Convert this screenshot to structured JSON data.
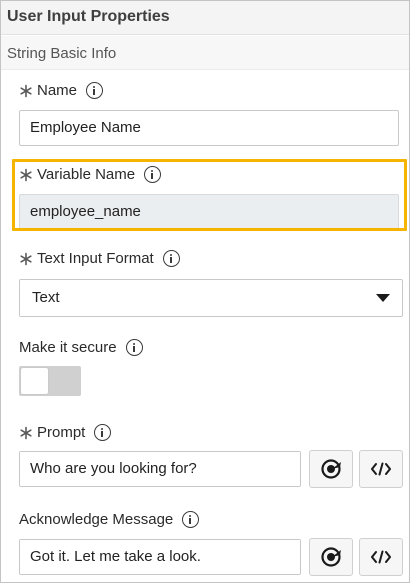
{
  "panel": {
    "title": "User Input Properties"
  },
  "section": {
    "title": "String Basic Info"
  },
  "fields": {
    "name": {
      "label": "Name",
      "value": "Employee Name",
      "required": true
    },
    "variable_name": {
      "label": "Variable Name",
      "value": "employee_name",
      "required": true,
      "read_only": true
    },
    "text_input_format": {
      "label": "Text Input Format",
      "selected": "Text",
      "required": true
    },
    "make_it_secure": {
      "label": "Make it secure",
      "on": false
    },
    "prompt": {
      "label": "Prompt",
      "value": "Who are you looking for?",
      "required": true
    },
    "acknowledge_message": {
      "label": "Acknowledge Message",
      "value": "Got it. Let me take a look."
    }
  },
  "icons": {
    "required": "asterisk-icon",
    "info": "info-icon",
    "dropdown": "caret-down-icon",
    "target": "target-icon",
    "code": "code-icon"
  },
  "colors": {
    "highlight": "#f5b400",
    "readonly_field": "#eaeef1",
    "toggle_off": "#d0d0d0",
    "header_bg": "#f4f4f4"
  }
}
